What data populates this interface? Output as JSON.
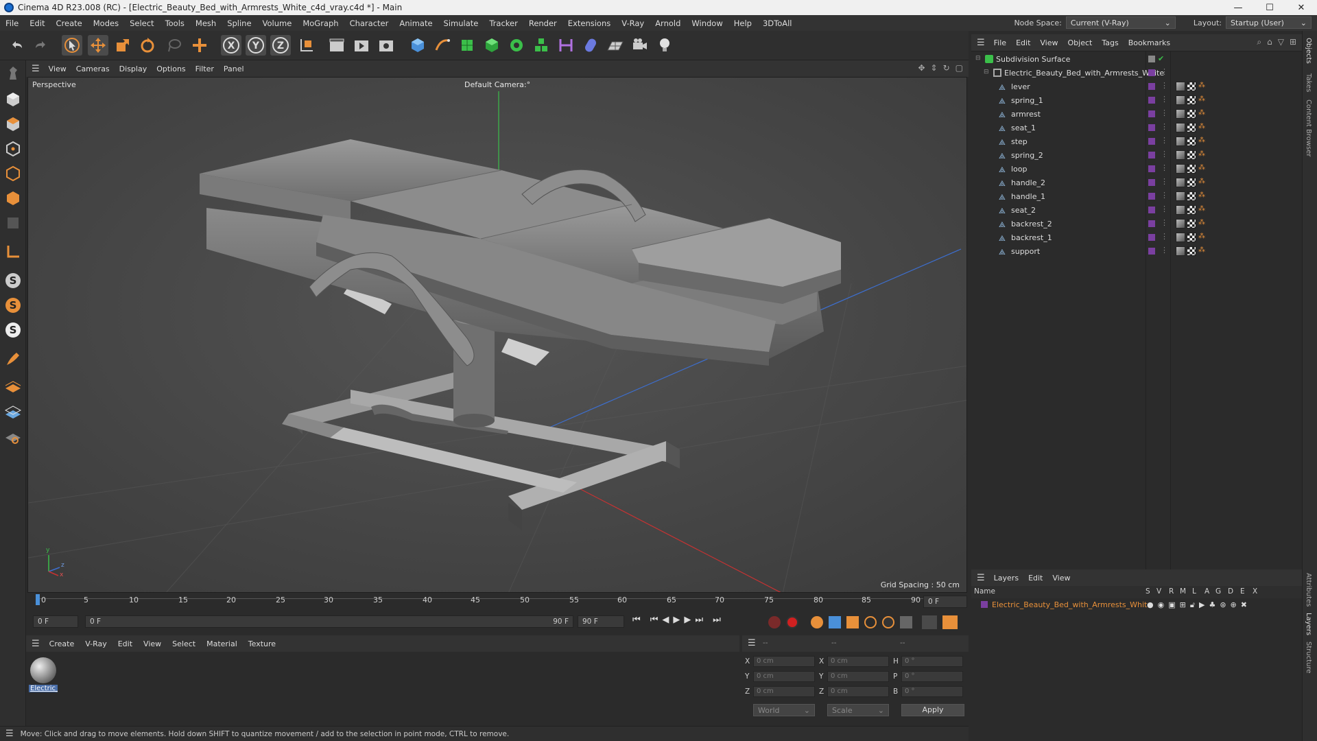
{
  "window": {
    "title": "Cinema 4D R23.008 (RC) - [Electric_Beauty_Bed_with_Armrests_White_c4d_vray.c4d *] - Main",
    "controls": [
      "—",
      "☐",
      "✕"
    ]
  },
  "menubar": {
    "items": [
      "File",
      "Edit",
      "Create",
      "Modes",
      "Select",
      "Tools",
      "Mesh",
      "Spline",
      "Volume",
      "MoGraph",
      "Character",
      "Animate",
      "Simulate",
      "Tracker",
      "Render",
      "Extensions",
      "V-Ray",
      "Arnold",
      "Window",
      "Help",
      "3DToAll"
    ],
    "node_space_label": "Node Space:",
    "node_space_value": "Current (V-Ray)",
    "layout_label": "Layout:",
    "layout_value": "Startup (User)"
  },
  "viewport": {
    "menu": [
      "View",
      "Cameras",
      "Display",
      "Options",
      "Filter",
      "Panel"
    ],
    "view_name": "Perspective",
    "camera": "Default Camera",
    "camera_suffix": ":°",
    "grid_spacing": "Grid Spacing : 50 cm",
    "axis_labels": {
      "y": "y",
      "z": "z",
      "x": "x"
    }
  },
  "timeline": {
    "ticks": [
      "0",
      "5",
      "10",
      "15",
      "20",
      "25",
      "30",
      "35",
      "40",
      "45",
      "50",
      "55",
      "60",
      "65",
      "70",
      "75",
      "80",
      "85",
      "90"
    ],
    "current_frame": "0 F",
    "start_field": "0 F",
    "range_start": "0 F",
    "range_end": "90 F",
    "end_field": "90 F"
  },
  "material_manager": {
    "menu": [
      "Create",
      "V-Ray",
      "Edit",
      "View",
      "Select",
      "Material",
      "Texture"
    ],
    "material_name": "Electric_I"
  },
  "coordinates": {
    "headers": [
      "--",
      "--",
      "--"
    ],
    "rows": [
      {
        "axis": "X",
        "pos": "0 cm",
        "axis2": "X",
        "size": "0 cm",
        "axis3": "H",
        "rot": "0 °"
      },
      {
        "axis": "Y",
        "pos": "0 cm",
        "axis2": "Y",
        "size": "0 cm",
        "axis3": "P",
        "rot": "0 °"
      },
      {
        "axis": "Z",
        "pos": "0 cm",
        "axis2": "Z",
        "size": "0 cm",
        "axis3": "B",
        "rot": "0 °"
      }
    ],
    "mode": "World",
    "scale": "Scale",
    "apply": "Apply"
  },
  "status_bar": {
    "text": "Move: Click and drag to move elements. Hold down SHIFT to quantize movement / add to the selection in point mode, CTRL to remove."
  },
  "object_manager": {
    "menu": [
      "File",
      "Edit",
      "View",
      "Object",
      "Tags",
      "Bookmarks"
    ],
    "root": "Subdivision Surface",
    "group": "Electric_Beauty_Bed_with_Armrests_White",
    "children": [
      "lever",
      "spring_1",
      "armrest",
      "seat_1",
      "step",
      "spring_2",
      "loop",
      "handle_2",
      "handle_1",
      "seat_2",
      "backrest_2",
      "backrest_1",
      "support"
    ]
  },
  "layer_manager": {
    "menu": [
      "Layers",
      "Edit",
      "View"
    ],
    "columns": [
      "Name",
      "S",
      "V",
      "R",
      "M",
      "L",
      "A",
      "G",
      "D",
      "E",
      "X"
    ],
    "layer_name": "Electric_Beauty_Bed_with_Armrests_White",
    "layer_color": "#7a3fa0"
  },
  "side_tabs": [
    "Objects",
    "Takes",
    "Content Browser",
    "Attributes",
    "Layers",
    "Structure"
  ],
  "colors": {
    "accent_orange": "#e8903a",
    "active_blue": "#4a90d9",
    "record_red": "#d02020"
  }
}
